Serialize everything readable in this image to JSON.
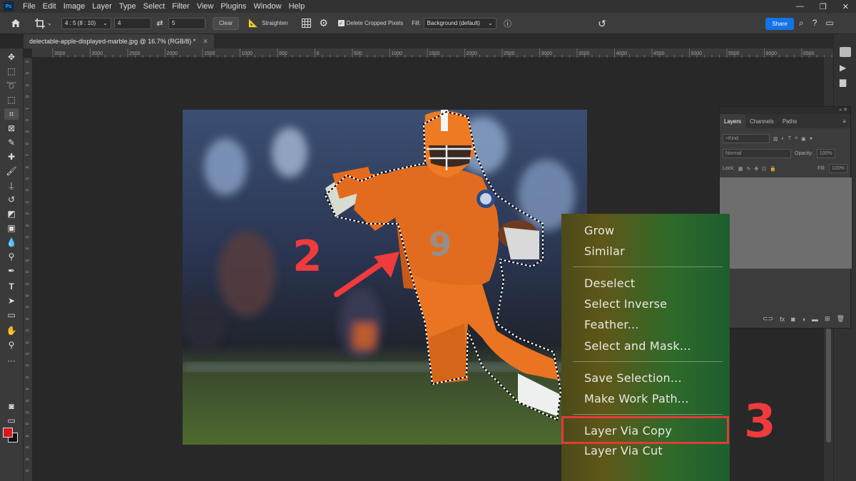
{
  "app": {
    "logo": "Ps"
  },
  "menubar": {
    "items": [
      "File",
      "Edit",
      "Image",
      "Layer",
      "Type",
      "Select",
      "Filter",
      "View",
      "Plugins",
      "Window",
      "Help"
    ],
    "window_controls": [
      "—",
      "❐",
      "✕"
    ]
  },
  "options": {
    "ratio": "4 : 5 (8 : 10)",
    "width": "4",
    "height": "5",
    "clear_label": "Clear",
    "straighten_label": "Straighten",
    "delete_cropped_label": "Delete Cropped Pixels",
    "delete_cropped_checked": true,
    "fill_label": "Fill:",
    "fill_value": "Background (default)",
    "share_label": "Share"
  },
  "document": {
    "tab_title": "delectable-apple-displayed-marble.jpg @ 16.7% (RGB/8) *"
  },
  "ruler_h": [
    "3500",
    "3000",
    "2500",
    "2000",
    "1500",
    "1000",
    "500",
    "0",
    "500",
    "1000",
    "1500",
    "2000",
    "2500",
    "3000",
    "3500",
    "4000",
    "4500",
    "5000",
    "5500",
    "6000",
    "6500"
  ],
  "ruler_v": [
    "0",
    "5",
    "0",
    "0",
    "1",
    "0",
    "0",
    "0",
    "1",
    "5",
    "0",
    "0",
    "2",
    "0",
    "0",
    "0",
    "2",
    "5",
    "0",
    "0",
    "3",
    "0",
    "0",
    "0",
    "3",
    "5",
    "0",
    "0",
    "4",
    "0",
    "0",
    "0",
    "4",
    "5",
    "0",
    "0"
  ],
  "layers_panel": {
    "tabs": [
      "Layers",
      "Channels",
      "Paths"
    ],
    "kind_label": "Kind",
    "blend_mode": "Normal",
    "opacity_label": "Opacity:",
    "opacity_value": "100%",
    "lock_label": "Lock:",
    "fill_label": "Fill:",
    "fill_value": "100%"
  },
  "context_menu": {
    "items": [
      "Grow",
      "Similar",
      "Deselect",
      "Select Inverse",
      "Feather...",
      "Select and Mask...",
      "Save Selection...",
      "Make Work Path...",
      "Layer Via Copy",
      "Layer Via Cut"
    ],
    "highlighted": "Layer Via Copy"
  },
  "annotations": {
    "step2": "2",
    "step3": "3",
    "color": "#ef3b3b"
  },
  "photo": {
    "jersey_number": "9"
  },
  "colors": {
    "accent": "#1473e6",
    "foreground": "#d4181d",
    "background": "#111111"
  }
}
